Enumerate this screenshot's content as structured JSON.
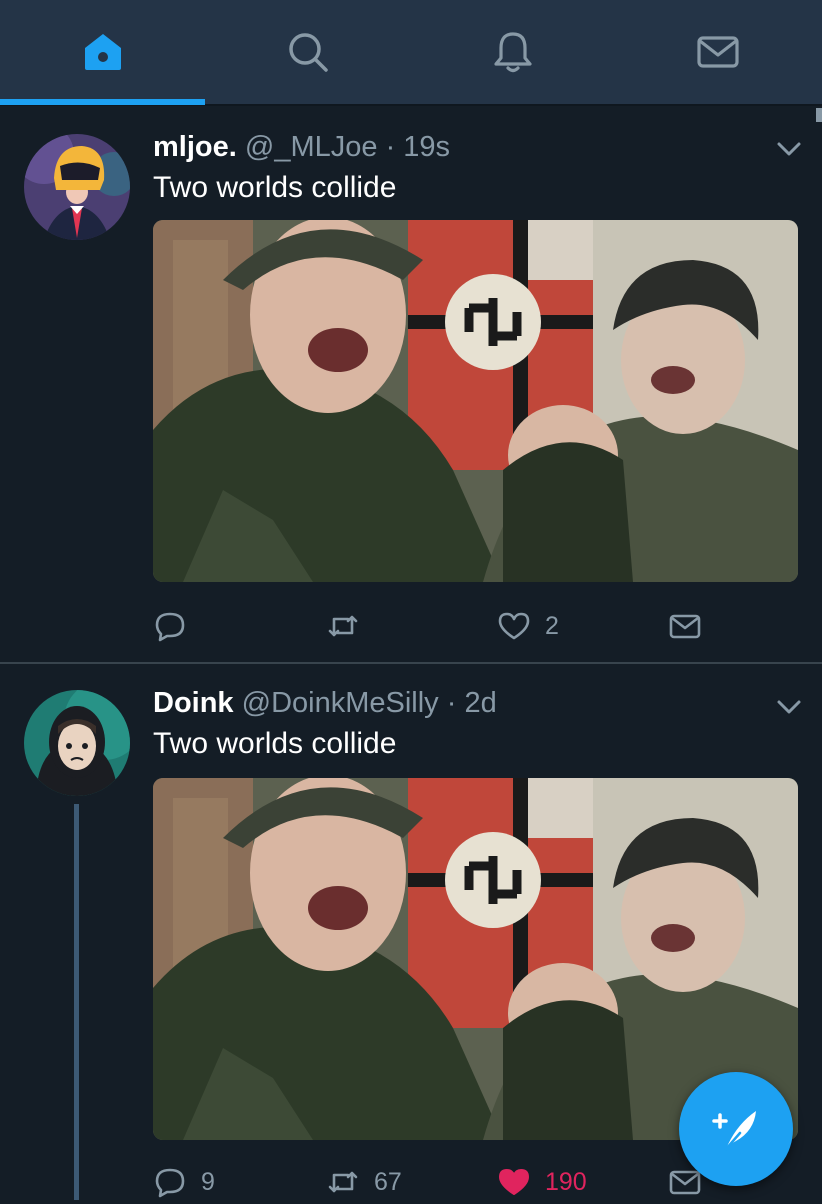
{
  "nav": {
    "tabs": [
      {
        "name": "home",
        "icon": "home-icon",
        "active": true
      },
      {
        "name": "search",
        "icon": "search-icon",
        "active": false
      },
      {
        "name": "notifications",
        "icon": "bell-icon",
        "active": false
      },
      {
        "name": "messages",
        "icon": "mail-icon",
        "active": false
      }
    ]
  },
  "colors": {
    "accent": "#1da1f2",
    "background": "#141d26",
    "header_background": "#243447",
    "muted_text": "#8899a6",
    "liked": "#e0245e"
  },
  "tweets": [
    {
      "display_name": "mljoe.",
      "handle": "@_MLJoe",
      "separator": "·",
      "time": "19s",
      "text": "Two worlds collide",
      "reply_count": "",
      "retweet_count": "",
      "like_count": "2",
      "liked": false
    },
    {
      "display_name": "Doink",
      "handle": "@DoinkMeSilly",
      "separator": "·",
      "time": "2d",
      "text": "Two worlds collide",
      "reply_count": "9",
      "retweet_count": "67",
      "like_count": "190",
      "liked": true
    }
  ],
  "compose": {
    "icon": "compose-tweet-icon"
  }
}
